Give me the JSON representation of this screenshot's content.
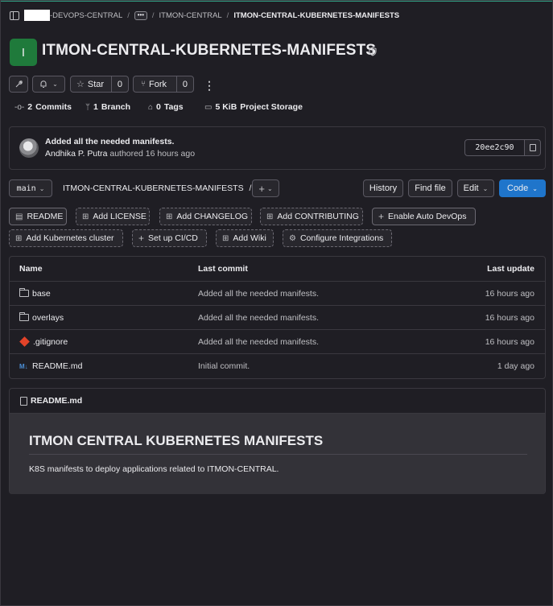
{
  "breadcrumb": {
    "group": "-DEVOPS-CENTRAL",
    "ellipsis": "•••",
    "subgroup": "ITMON-CENTRAL",
    "current": "ITMON-CENTRAL-KUBERNETES-MANIFESTS"
  },
  "project": {
    "avatar_letter": "I",
    "title": "ITMON-CENTRAL-KUBERNETES-MANIFESTS"
  },
  "actions": {
    "star_label": "Star",
    "star_count": "0",
    "fork_label": "Fork",
    "fork_count": "0"
  },
  "stats": {
    "commits_count": "2",
    "commits_label": "Commits",
    "branches_count": "1",
    "branches_label": "Branch",
    "tags_count": "0",
    "tags_label": "Tags",
    "storage_size": "5 KiB",
    "storage_label": "Project Storage"
  },
  "last_commit": {
    "message": "Added all the needed manifests.",
    "author": "Andhika P. Putra",
    "authored_text": "authored 16 hours ago",
    "sha": "20ee2c90"
  },
  "repo_nav": {
    "branch": "main",
    "path": "ITMON-CENTRAL-KUBERNETES-MANIFESTS",
    "path_sep": "/",
    "history": "History",
    "find_file": "Find file",
    "edit": "Edit",
    "code": "Code"
  },
  "shortcuts": {
    "readme": "README",
    "add_license": "Add LICENSE",
    "add_changelog": "Add CHANGELOG",
    "add_contributing": "Add CONTRIBUTING",
    "auto_devops": "Enable Auto DevOps",
    "k8s_cluster": "Add Kubernetes cluster",
    "ci_cd": "Set up CI/CD",
    "add_wiki": "Add Wiki",
    "integrations": "Configure Integrations"
  },
  "file_table": {
    "headers": [
      "Name",
      "Last commit",
      "Last update"
    ],
    "rows": [
      {
        "name": "base",
        "icon": "folder-icon",
        "commit": "Added all the needed manifests.",
        "updated": "16 hours ago"
      },
      {
        "name": "overlays",
        "icon": "folder-icon",
        "commit": "Added all the needed manifests.",
        "updated": "16 hours ago"
      },
      {
        "name": ".gitignore",
        "icon": "git-icon",
        "commit": "Added all the needed manifests.",
        "updated": "16 hours ago"
      },
      {
        "name": "README.md",
        "icon": "markdown-icon",
        "commit": "Initial commit.",
        "updated": "1 day ago"
      }
    ]
  },
  "readme": {
    "filename": "README.md",
    "heading": "ITMON CENTRAL KUBERNETES MANIFESTS",
    "text": "K8S manifests to deploy applications related to ITMON-CENTRAL."
  },
  "colors": {
    "background": "#1f1e24",
    "accent_blue": "#1f75cb",
    "project_avatar": "#1f7a3b",
    "top_line": "#2f9e83"
  }
}
